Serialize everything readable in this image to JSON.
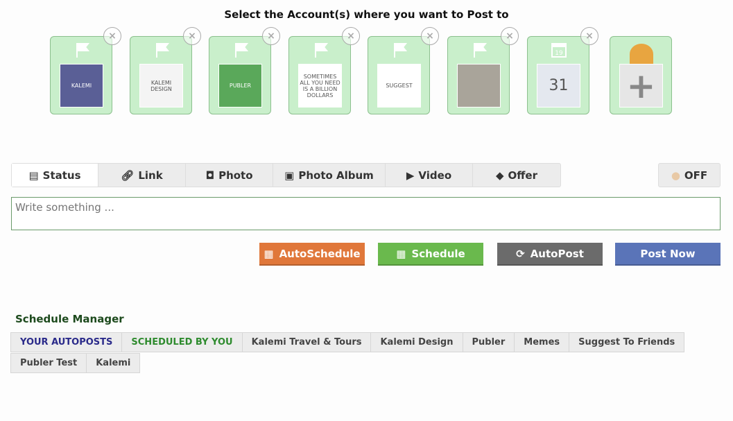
{
  "title": "Select the Account(s) where you want to Post to",
  "accounts": [
    {
      "name": "Kalemi",
      "thumb_text": "KALEMI",
      "type": "page",
      "color": "#5a5f96"
    },
    {
      "name": "Kalemi Design",
      "thumb_text": "KALEMI DESIGN",
      "type": "page",
      "color": "#f4f4f4"
    },
    {
      "name": "Publer",
      "thumb_text": "PUBLER",
      "type": "page",
      "color": "#5aa85a"
    },
    {
      "name": "Memes",
      "thumb_text": "SOMETIMES ALL YOU NEED IS A BILLION DOLLARS",
      "type": "page",
      "color": "#ffffff"
    },
    {
      "name": "Suggest To Friends",
      "thumb_text": "SUGGEST",
      "type": "page",
      "color": "#ffffff"
    },
    {
      "name": "Kalemi Travel & Tours",
      "thumb_text": "",
      "type": "page",
      "color": "#a9a49a"
    },
    {
      "name": "Publer Test",
      "thumb_text": "31",
      "type": "calendar",
      "color": "#e4e8ef"
    }
  ],
  "add_account_icon": "plus-icon",
  "tabs": [
    {
      "label": "Status",
      "icon": "document-icon"
    },
    {
      "label": "Link",
      "icon": "link-icon"
    },
    {
      "label": "Photo",
      "icon": "camera-icon"
    },
    {
      "label": "Photo Album",
      "icon": "image-icon"
    },
    {
      "label": "Video",
      "icon": "video-icon"
    },
    {
      "label": "Offer",
      "icon": "tag-icon"
    }
  ],
  "toggle_label": "OFF",
  "compose_placeholder": "Write something ...",
  "buttons": [
    {
      "label": "AutoSchedule",
      "color": "#e0773a"
    },
    {
      "label": "Schedule",
      "color": "#6ab94d"
    },
    {
      "label": "AutoPost",
      "color": "#6b6b6b"
    },
    {
      "label": "Post Now",
      "color": "#5a74b8"
    }
  ],
  "schedule_manager": {
    "title": "Schedule Manager",
    "row1": [
      {
        "label": "YOUR AUTOPOSTS",
        "color": "#2a2a8a"
      },
      {
        "label": "SCHEDULED BY YOU",
        "color": "#2e8b2e"
      },
      {
        "label": "Kalemi Travel & Tours"
      },
      {
        "label": "Kalemi Design"
      },
      {
        "label": "Publer"
      },
      {
        "label": "Memes"
      },
      {
        "label": "Suggest To Friends"
      }
    ],
    "row2": [
      {
        "label": "Publer Test"
      },
      {
        "label": "Kalemi"
      }
    ]
  }
}
